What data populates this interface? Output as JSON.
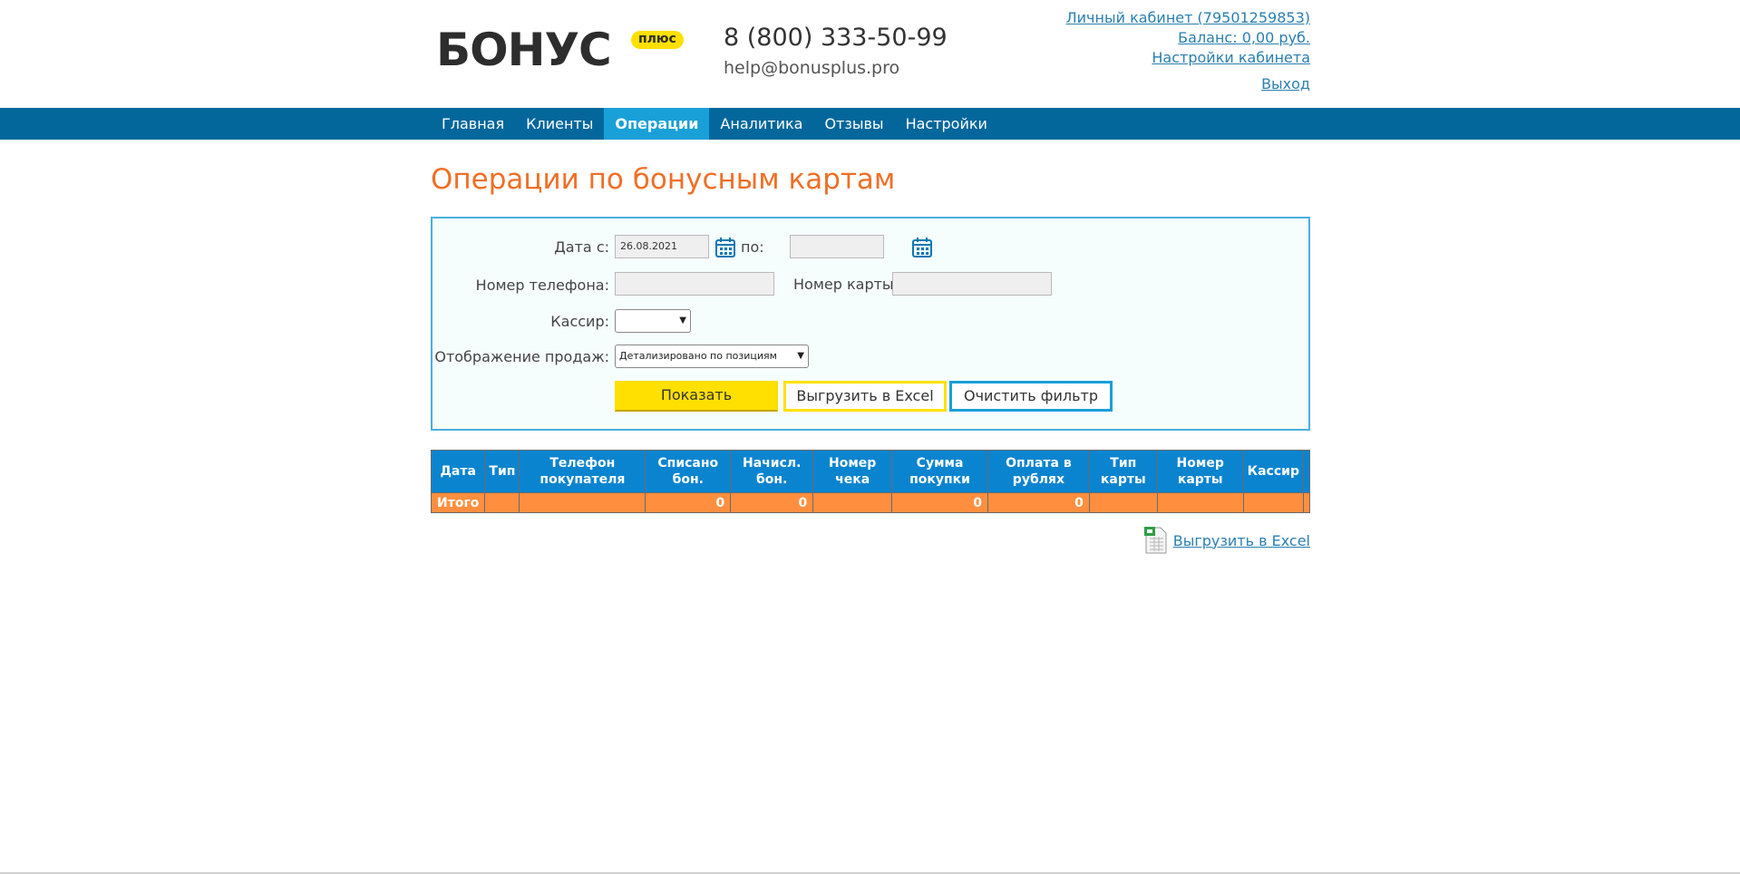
{
  "logo": {
    "text": "БОНУС",
    "badge": "плюс"
  },
  "contacts": {
    "phone": "8 (800) 333-50-99",
    "email": "help@bonusplus.pro"
  },
  "account": {
    "cabinet": "Личный кабинет (79501259853)",
    "balance": "Баланс: 0,00 руб.",
    "settings": "Настройки кабинета",
    "logout": "Выход"
  },
  "nav": [
    "Главная",
    "Клиенты",
    "Операции",
    "Аналитика",
    "Отзывы",
    "Настройки"
  ],
  "nav_active": "Операции",
  "page_title": "Операции по бонусным картам",
  "filter": {
    "date_from_label": "Дата с:",
    "date_from_value": "26.08.2021",
    "date_to_label": "по:",
    "date_to_value": "",
    "phone_label": "Номер телефона:",
    "phone_value": "",
    "card_label": "Номер карты:",
    "card_value": "",
    "cashier_label": "Кассир:",
    "cashier_value": "",
    "display_label": "Отображение продаж:",
    "display_value": "Детализировано по позициям",
    "show_button": "Показать",
    "excel_button": "Выгрузить в Excel",
    "clear_button": "Очистить фильтр"
  },
  "table": {
    "columns": [
      "Дата",
      "Тип",
      "Телефон покупателя",
      "Списано бон.",
      "Начисл. бон.",
      "Номер чека",
      "Сумма покупки",
      "Оплата в рублях",
      "Тип карты",
      "Номер карты",
      "Кассир",
      ""
    ],
    "total_row": [
      "Итого",
      "",
      "",
      "0",
      "0",
      "",
      "0",
      "0",
      "",
      "",
      "",
      ""
    ]
  },
  "export_link": "Выгрузить в Excel",
  "colors": {
    "nav_bg": "#03679c",
    "nav_active": "#1aa0d8",
    "title": "#f06f26",
    "header_bg": "#0b84d0",
    "total_bg": "#ff8f3f",
    "yellow": "#ffe000"
  }
}
